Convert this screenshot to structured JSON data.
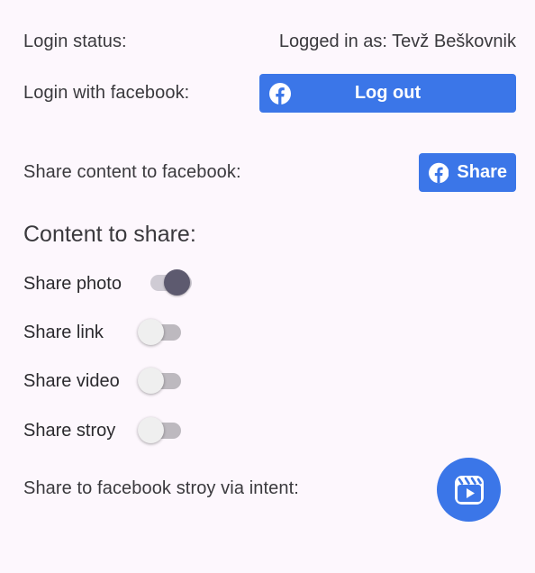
{
  "login": {
    "status_label": "Login status:",
    "status_value": "Logged in as: Tevž Beškovnik",
    "facebook_label": "Login with facebook:",
    "logout_button": "Log out"
  },
  "share": {
    "label": "Share content to facebook:",
    "button": "Share"
  },
  "content": {
    "title": "Content to share:",
    "switches": [
      {
        "label": "Share photo",
        "checked": true
      },
      {
        "label": "Share link",
        "checked": false
      },
      {
        "label": "Share video",
        "checked": false
      },
      {
        "label": "Share stroy",
        "checked": false
      }
    ]
  },
  "intent": {
    "label": "Share to facebook stroy via intent:",
    "icon": "reels-icon"
  },
  "colors": {
    "facebook_blue": "#3b76e8",
    "background": "#fdf7fd",
    "switch_on_thumb": "#5d5a6f"
  }
}
